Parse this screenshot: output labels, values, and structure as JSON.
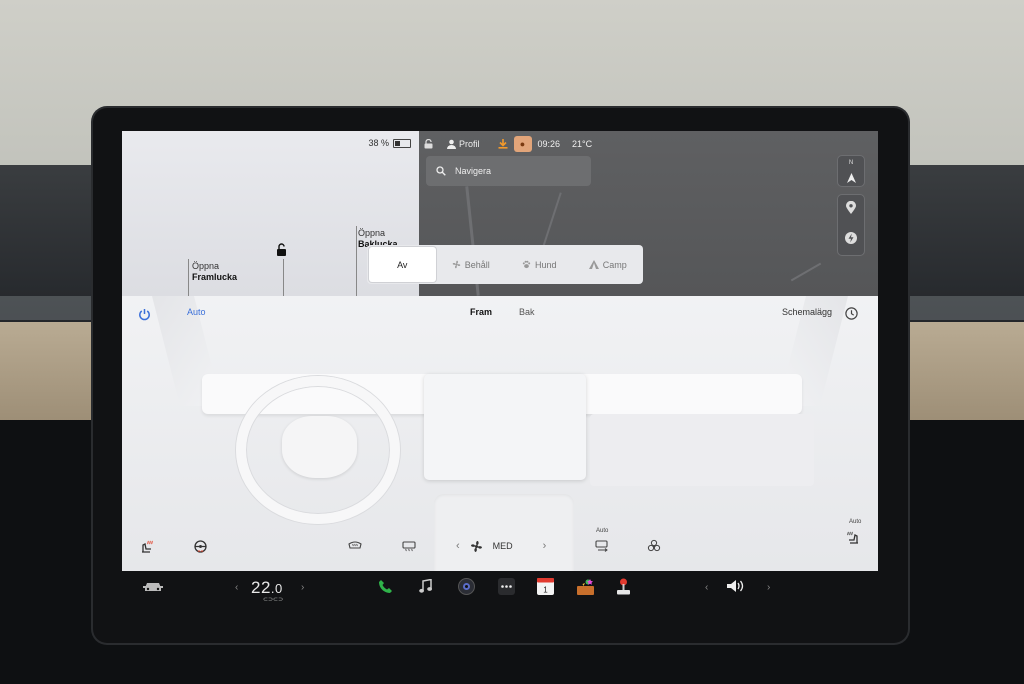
{
  "status": {
    "battery_percent": "38 %",
    "battery_level": 0.38,
    "profile_label": "Profil",
    "time": "09:26",
    "outside_temp": "21°C"
  },
  "car_pane": {
    "frunk_action": "Öppna",
    "frunk_name": "Framlucka",
    "trunk_action": "Öppna",
    "trunk_name": "Baklucka"
  },
  "map": {
    "search_placeholder": "Navigera",
    "compass_letters": "N"
  },
  "climate_keeper": {
    "options": [
      "Av",
      "Behåll",
      "Hund",
      "Camp"
    ],
    "selected": "Av"
  },
  "climate": {
    "auto_label": "Auto",
    "tab_front": "Fram",
    "tab_rear": "Bak",
    "schedule_label": "Schemalägg",
    "fan_level": "MED",
    "auto_small_1": "Auto",
    "auto_small_2": "Auto"
  },
  "dock": {
    "cabin_temp_whole": "22",
    "cabin_temp_decimal": ".0",
    "calendar_day": "1",
    "colors": {
      "phone": "#2fb34a",
      "calendar": "#e23a2f",
      "joystick": "#e23a2f"
    }
  },
  "icons": {
    "car": "car-icon",
    "phone": "phone-icon",
    "music": "music-note-icon",
    "camera": "camera-icon",
    "more": "dots-icon",
    "calendar": "calendar-icon",
    "toybox": "toybox-icon",
    "arcade": "joystick-icon",
    "volume": "speaker-icon"
  }
}
